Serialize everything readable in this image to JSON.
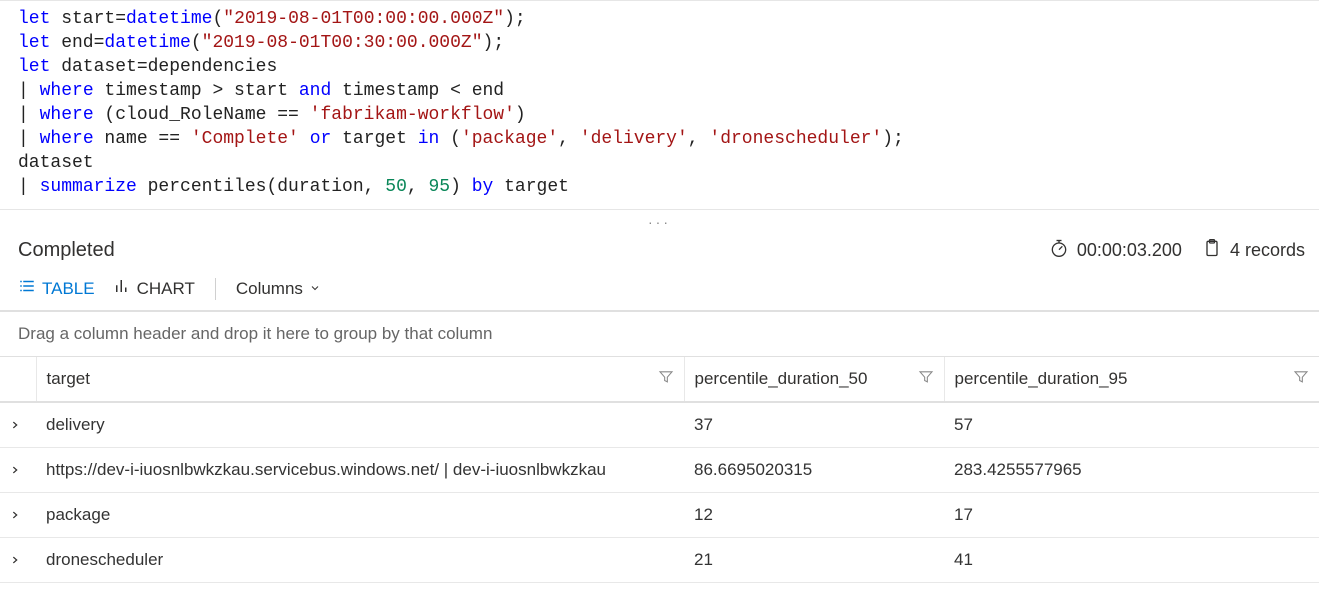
{
  "query": {
    "tokens": [
      [
        {
          "t": "kw-let",
          "v": "let"
        },
        {
          "t": "",
          "v": " start="
        },
        {
          "t": "fn",
          "v": "datetime"
        },
        {
          "t": "",
          "v": "("
        },
        {
          "t": "str",
          "v": "\"2019-08-01T00:00:00.000Z\""
        },
        {
          "t": "",
          "v": ");"
        }
      ],
      [
        {
          "t": "kw-let",
          "v": "let"
        },
        {
          "t": "",
          "v": " end="
        },
        {
          "t": "fn",
          "v": "datetime"
        },
        {
          "t": "",
          "v": "("
        },
        {
          "t": "str",
          "v": "\"2019-08-01T00:30:00.000Z\""
        },
        {
          "t": "",
          "v": ");"
        }
      ],
      [
        {
          "t": "kw-let",
          "v": "let"
        },
        {
          "t": "",
          "v": " dataset=dependencies"
        }
      ],
      [
        {
          "t": "pipe",
          "v": "| "
        },
        {
          "t": "kw-op",
          "v": "where"
        },
        {
          "t": "",
          "v": " timestamp > start "
        },
        {
          "t": "kw-op",
          "v": "and"
        },
        {
          "t": "",
          "v": " timestamp < end"
        }
      ],
      [
        {
          "t": "pipe",
          "v": "| "
        },
        {
          "t": "kw-op",
          "v": "where"
        },
        {
          "t": "",
          "v": " (cloud_RoleName == "
        },
        {
          "t": "str",
          "v": "'fabrikam-workflow'"
        },
        {
          "t": "",
          "v": ")"
        }
      ],
      [
        {
          "t": "pipe",
          "v": "| "
        },
        {
          "t": "kw-op",
          "v": "where"
        },
        {
          "t": "",
          "v": " name == "
        },
        {
          "t": "str",
          "v": "'Complete'"
        },
        {
          "t": "",
          "v": " "
        },
        {
          "t": "kw-op",
          "v": "or"
        },
        {
          "t": "",
          "v": " target "
        },
        {
          "t": "kw-op",
          "v": "in"
        },
        {
          "t": "",
          "v": " ("
        },
        {
          "t": "str",
          "v": "'package'"
        },
        {
          "t": "",
          "v": ", "
        },
        {
          "t": "str",
          "v": "'delivery'"
        },
        {
          "t": "",
          "v": ", "
        },
        {
          "t": "str",
          "v": "'dronescheduler'"
        },
        {
          "t": "",
          "v": ");"
        }
      ],
      [
        {
          "t": "",
          "v": "dataset"
        }
      ],
      [
        {
          "t": "pipe",
          "v": "| "
        },
        {
          "t": "kw-op",
          "v": "summarize"
        },
        {
          "t": "",
          "v": " percentiles(duration, "
        },
        {
          "t": "num",
          "v": "50"
        },
        {
          "t": "",
          "v": ", "
        },
        {
          "t": "num",
          "v": "95"
        },
        {
          "t": "",
          "v": ") "
        },
        {
          "t": "kw-op",
          "v": "by"
        },
        {
          "t": "",
          "v": " target"
        }
      ]
    ]
  },
  "status": {
    "label": "Completed",
    "duration": "00:00:03.200",
    "record_count": "4 records"
  },
  "tabs": {
    "table": "TABLE",
    "chart": "CHART",
    "columns": "Columns"
  },
  "grid": {
    "group_hint": "Drag a column header and drop it here to group by that column",
    "columns": {
      "target": "target",
      "p50": "percentile_duration_50",
      "p95": "percentile_duration_95"
    },
    "rows": [
      {
        "target": "delivery",
        "p50": "37",
        "p95": "57"
      },
      {
        "target": "https://dev-i-iuosnlbwkzkau.servicebus.windows.net/ | dev-i-iuosnlbwkzkau",
        "p50": "86.6695020315",
        "p95": "283.4255577965"
      },
      {
        "target": "package",
        "p50": "12",
        "p95": "17"
      },
      {
        "target": "dronescheduler",
        "p50": "21",
        "p95": "41"
      }
    ]
  }
}
